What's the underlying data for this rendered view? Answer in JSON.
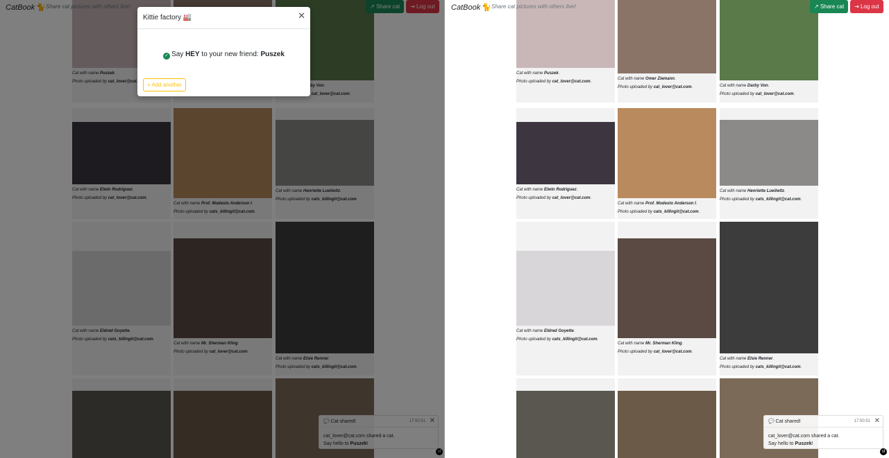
{
  "app": {
    "brand": "CatBook",
    "tagline": "Share cat pictures with others live!"
  },
  "nav": {
    "share_label": "Share cat",
    "logout_label": "Log out"
  },
  "caption": {
    "name_prefix": "Cat with name ",
    "uploader_prefix": "Photo uploaded by "
  },
  "cats": [
    {
      "name": "Puszek",
      "uploader": "cat_lover@cat.com"
    },
    {
      "name": "Omer Ziemann",
      "uploader": "cat_lover@cat.com"
    },
    {
      "name": "Darby Von",
      "uploader": "cat_lover@cat.com"
    },
    {
      "name": "Elwin Rodriguez",
      "uploader": "cat_lover@cat.com"
    },
    {
      "name": "Prof. Modesto Anderson I",
      "uploader": "cats_killingit@cat.com"
    },
    {
      "name": "Henriette Lueilwitz",
      "uploader": "cats_killingit@cat.com"
    },
    {
      "name": "Eldred Goyette",
      "uploader": "cats_killingit@cat.com"
    },
    {
      "name": "Mr. Sherman Kling",
      "uploader": "cat_lover@cat.com"
    },
    {
      "name": "Elsie Renner",
      "uploader": "cats_killingit@cat.com"
    },
    {
      "name": "",
      "uploader": ""
    },
    {
      "name": "",
      "uploader": ""
    },
    {
      "name": "",
      "uploader": ""
    }
  ],
  "modal": {
    "title": "Kittie factory",
    "message_prefix": "Say ",
    "message_hey": "HEY",
    "message_middle": " to your new friend: ",
    "friend_name": "Puszek",
    "add_another_label": "Add another"
  },
  "toast": {
    "title": "Cat shared!",
    "time": "17:50:51",
    "line1": "cat_lover@cat.com shared a cat.",
    "line2_prefix": "Say hello to ",
    "line2_name": "Puszek",
    "line2_suffix": "!"
  },
  "colors": {
    "share": "#198754",
    "logout": "#dc3545",
    "add_another": "#ffc107",
    "card_bg": "#f2f2f2"
  }
}
